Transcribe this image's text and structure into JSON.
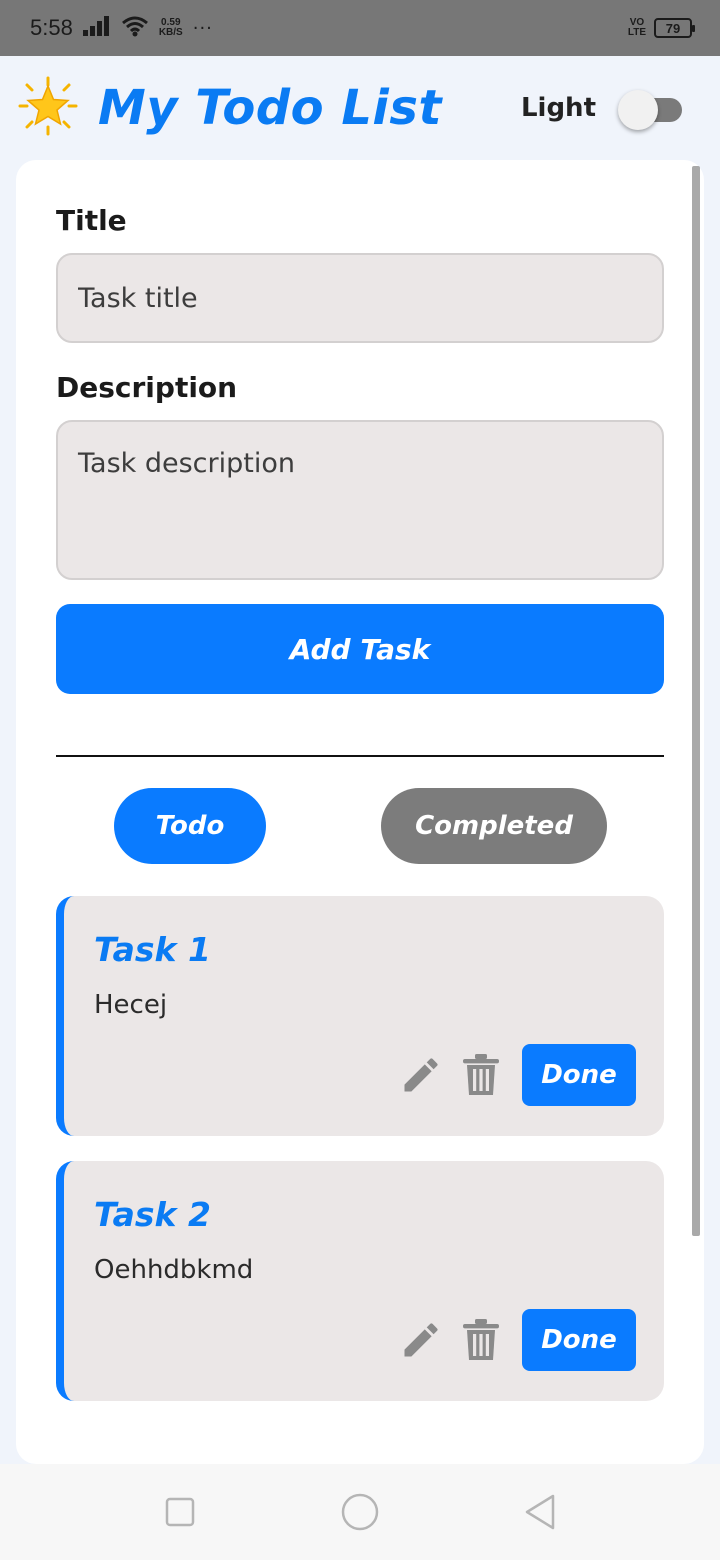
{
  "status_bar": {
    "time": "5:58",
    "speed_value": "0.59",
    "speed_unit": "KB/S",
    "more": "···",
    "volte_top": "VO",
    "volte_bottom": "LTE",
    "battery": "79"
  },
  "header": {
    "icon": "star-icon",
    "title": "My Todo List",
    "theme_label": "Light",
    "theme_toggle_on": false
  },
  "form": {
    "title_label": "Title",
    "title_placeholder": "Task title",
    "title_value": "",
    "description_label": "Description",
    "description_placeholder": "Task description",
    "description_value": "",
    "add_button": "Add Task"
  },
  "filters": {
    "todo": "Todo",
    "completed": "Completed",
    "active": "todo"
  },
  "tasks": [
    {
      "title": "Task 1",
      "description": "Hecej",
      "done_label": "Done"
    },
    {
      "title": "Task 2",
      "description": "Oehhdbkmd",
      "done_label": "Done"
    }
  ],
  "colors": {
    "accent": "#0a7bff",
    "card_background": "#ebe7e7",
    "inactive_pill": "#7c7c7c"
  },
  "nav": {
    "recent_icon": "square-icon",
    "home_icon": "circle-icon",
    "back_icon": "triangle-back-icon"
  }
}
